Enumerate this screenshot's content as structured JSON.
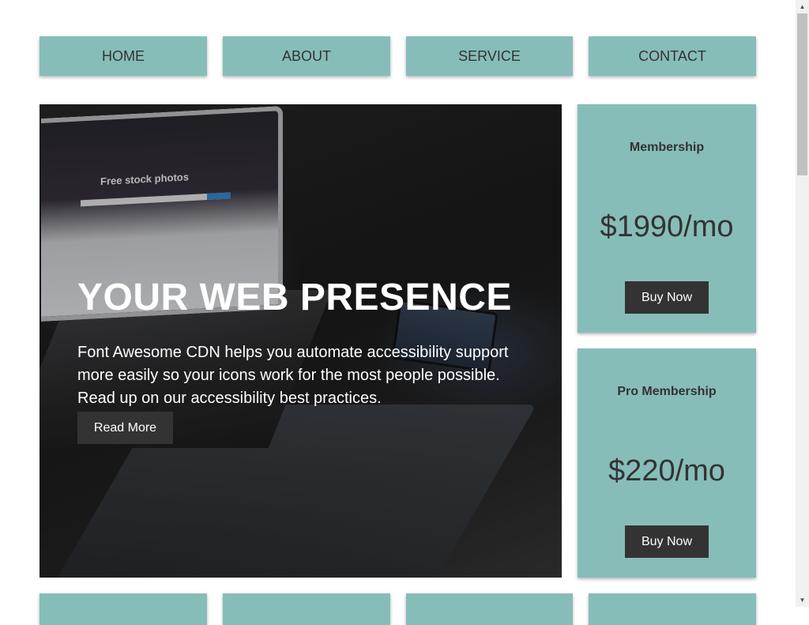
{
  "nav": {
    "items": [
      {
        "label": "HOME"
      },
      {
        "label": "ABOUT"
      },
      {
        "label": "SERVICE"
      },
      {
        "label": "CONTACT"
      }
    ]
  },
  "hero": {
    "title": "YOUR WEB PRESENCE",
    "text": "Font Awesome CDN helps you automate accessibility support more easily so your icons work for the most people possible. Read up on our accessibility best practices.",
    "button_label": "Read More",
    "image": {
      "screen_title": "Free stock photos"
    }
  },
  "pricing": [
    {
      "name": "Membership",
      "price": "$1990/mo",
      "button_label": "Buy Now"
    },
    {
      "name": "Pro Membership",
      "price": "$220/mo",
      "button_label": "Buy Now"
    }
  ],
  "colors": {
    "accent": "#87bdb9",
    "button_dark": "#333333",
    "text": "#333333",
    "background": "#ffffff"
  },
  "icons": {
    "scroll_up": "triangle-up-icon",
    "scroll_down": "triangle-down-icon"
  }
}
